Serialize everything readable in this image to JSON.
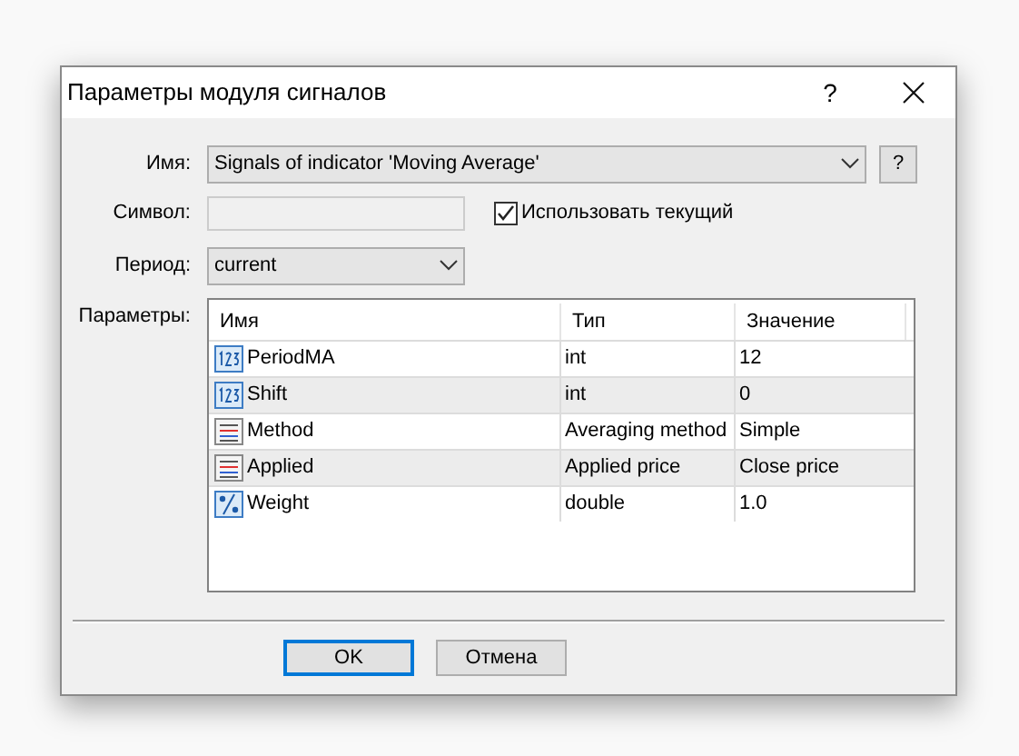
{
  "window": {
    "title": "Параметры модуля сигналов",
    "help": "?"
  },
  "name_field": {
    "label": "Имя:",
    "value": "Signals of indicator 'Moving Average'",
    "help_button": "?"
  },
  "symbol_field": {
    "label": "Символ:",
    "disabled": true,
    "use_current": {
      "label": "Использовать текущий",
      "checked": true
    }
  },
  "period_field": {
    "label": "Период:",
    "value": "current"
  },
  "parameters": {
    "label": "Параметры:",
    "columns": [
      "Имя",
      "Тип",
      "Значение"
    ],
    "rows": [
      {
        "kind": "integer",
        "name": "PeriodMA",
        "type": "int",
        "value": "12"
      },
      {
        "kind": "integer",
        "name": "Shift",
        "type": "int",
        "value": "0"
      },
      {
        "kind": "enum",
        "name": "Method",
        "type": "Averaging method",
        "value": "Simple"
      },
      {
        "kind": "enum",
        "name": "Applied",
        "type": "Applied price",
        "value": "Close price"
      },
      {
        "kind": "fraction",
        "name": "Weight",
        "type": "double",
        "value": "1.0"
      }
    ]
  },
  "buttons": [
    {
      "label": "OK",
      "default": true
    },
    {
      "label": "Отмена",
      "default": false
    }
  ]
}
